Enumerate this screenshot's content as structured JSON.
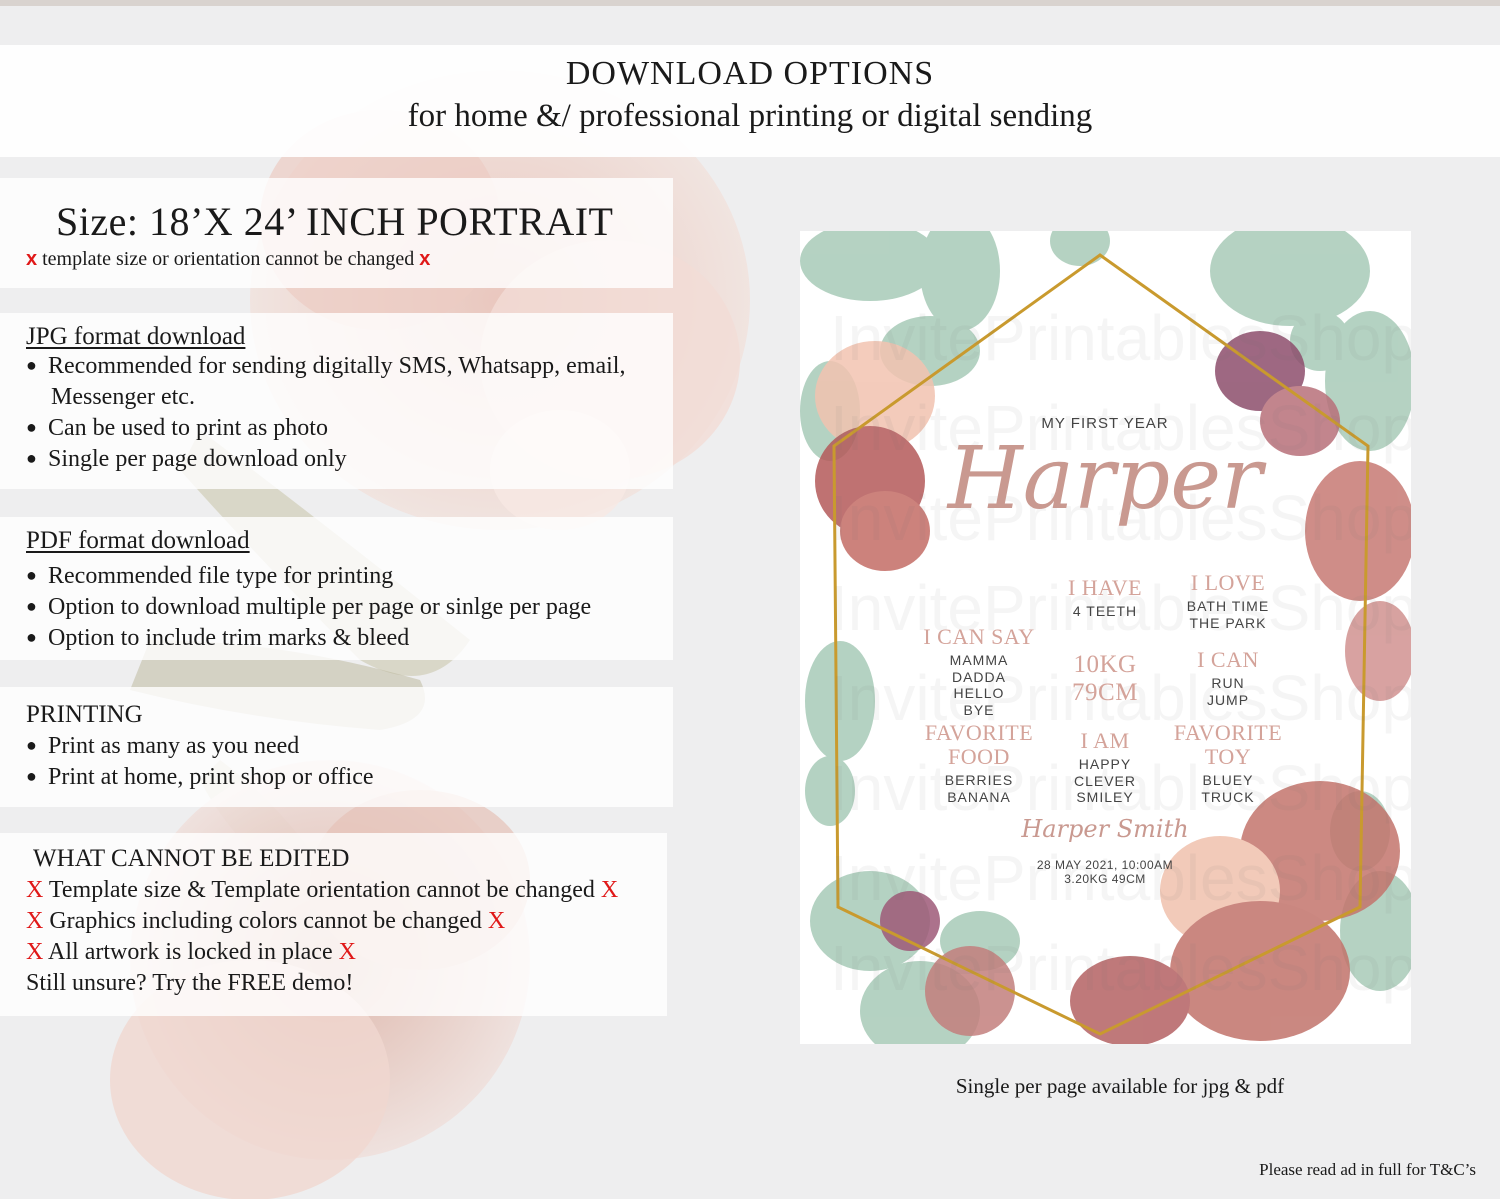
{
  "header": {
    "title": "DOWNLOAD OPTIONS",
    "subtitle": "for home &/ professional printing or digital sending"
  },
  "size_panel": {
    "title": "Size: 18’X 24’ INCH PORTRAIT",
    "x_mark": "x",
    "note": "template size or orientation cannot be changed"
  },
  "jpg_panel": {
    "heading": "JPG format download",
    "bullets": [
      "Recommended for sending digitally SMS, Whatsapp, email,",
      "Can be used to print as photo",
      "Single per page download only"
    ],
    "continuation": "Messenger etc."
  },
  "pdf_panel": {
    "heading": "PDF format download",
    "bullets": [
      "Recommended file type for printing",
      "Option to download multiple per page or sinlge per page",
      "Option to include trim marks & bleed"
    ]
  },
  "printing_panel": {
    "heading": "PRINTING",
    "bullets": [
      "Print as many as you need",
      "Print at home, print shop or office"
    ]
  },
  "cannot_panel": {
    "heading": "WHAT CANNOT BE EDITED",
    "x_mark": "X",
    "items": [
      "Template size & Template orientation cannot be changed",
      "Graphics including colors cannot be changed",
      "All artwork is locked in place"
    ],
    "closing": "Still unsure? Try the FREE demo!"
  },
  "poster": {
    "watermark": "InvitePrintablesShop",
    "subtitle": "MY FIRST YEAR",
    "name": "Harper",
    "i_have": {
      "heading": "I HAVE",
      "lines": [
        "4 TEETH"
      ]
    },
    "i_love": {
      "heading": "I LOVE",
      "lines": [
        "BATH TIME",
        "THE PARK"
      ]
    },
    "i_can_say": {
      "heading": "I CAN SAY",
      "lines": [
        "MAMMA",
        "DADDA",
        "HELLO",
        "BYE"
      ]
    },
    "stats": [
      "10KG",
      "79CM"
    ],
    "i_can": {
      "heading": "I CAN",
      "lines": [
        "RUN",
        "JUMP"
      ]
    },
    "favorite_food": {
      "heading": [
        "FAVORITE",
        "FOOD"
      ],
      "lines": [
        "BERRIES",
        "BANANA"
      ]
    },
    "i_am": {
      "heading": "I AM",
      "lines": [
        "HAPPY",
        "CLEVER",
        "SMILEY"
      ]
    },
    "favorite_toy": {
      "heading": [
        "FAVORITE",
        "TOY"
      ],
      "lines": [
        "BLUEY",
        "TRUCK"
      ]
    },
    "signature": "Harper Smith",
    "birth_lines": [
      "28 MAY 2021, 10:00AM",
      "3.20KG 49CM"
    ]
  },
  "caption": "Single per page available for jpg & pdf",
  "footer_note": "Please read ad in full for T&C’s",
  "colors": {
    "red_x": "#e01818",
    "poster_accent": "#d4a39a",
    "gold_frame": "#c99a2e"
  }
}
